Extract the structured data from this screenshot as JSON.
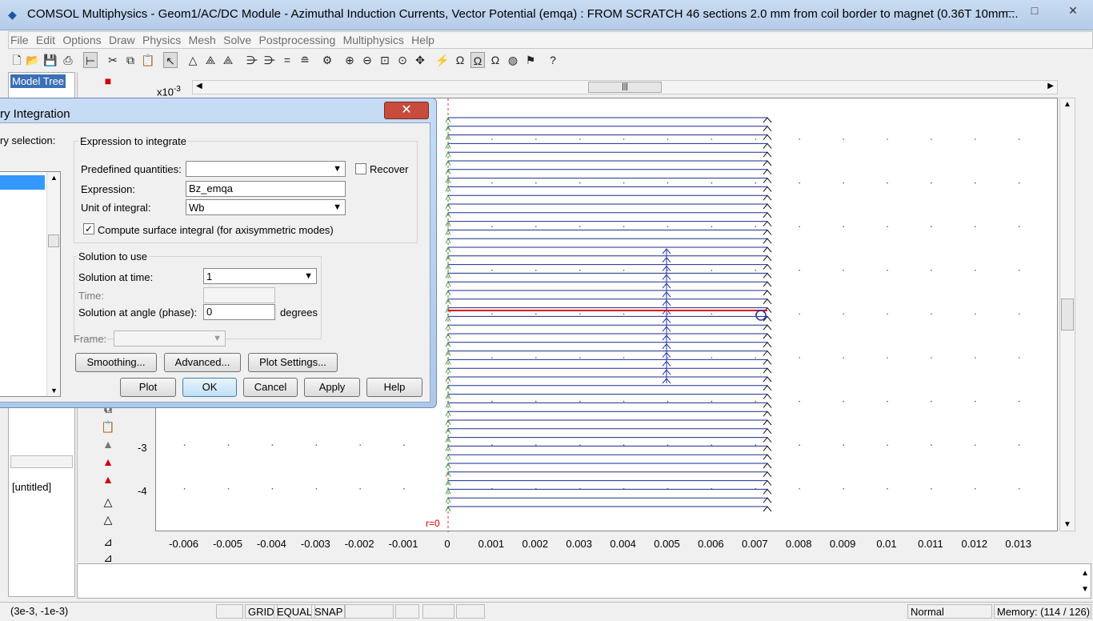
{
  "window": {
    "title": "COMSOL Multiphysics - Geom1/AC/DC Module - Azimuthal Induction Currents, Vector Potential (emqa) : FROM SCRATCH 46 sections 2.0 mm from coil border to magnet (0.36T 10mm...",
    "minimize": "—",
    "maximize": "□",
    "close": "✕"
  },
  "menu": [
    "File",
    "Edit",
    "Options",
    "Draw",
    "Physics",
    "Mesh",
    "Solve",
    "Postprocessing",
    "Multiphysics",
    "Help"
  ],
  "left_panel": {
    "tab": "Model Tree",
    "untitled": "[untitled]"
  },
  "plot": {
    "exponent_label": "x10",
    "exponent_power": "-3",
    "x_ticks": [
      "-0.006",
      "-0.005",
      "-0.004",
      "-0.003",
      "-0.002",
      "-0.001",
      "0",
      "0.001",
      "0.002",
      "0.003",
      "0.004",
      "0.005",
      "0.006",
      "0.007",
      "0.008",
      "0.009",
      "0.01",
      "0.011",
      "0.012",
      "0.013"
    ],
    "y_ticks": [
      "-3",
      "-4"
    ],
    "r0_label": "r=0"
  },
  "dialog": {
    "title": "ry Integration",
    "close": "✕",
    "boundary_selection_label": "ry selection:",
    "expression_group": "Expression to integrate",
    "predefined_label": "Predefined quantities:",
    "predefined_value": "",
    "recover_label": "Recover",
    "expression_label": "Expression:",
    "expression_value": "Bz_emqa",
    "unit_label": "Unit of integral:",
    "unit_value": "Wb",
    "compute_surface_label": "Compute surface integral (for axisymmetric modes)",
    "solution_group": "Solution to use",
    "solution_time_label": "Solution at time:",
    "solution_time_value": "1",
    "time_label": "Time:",
    "time_value": "",
    "angle_label": "Solution at angle (phase):",
    "angle_value": "0",
    "degrees_label": "degrees",
    "frame_label": "Frame:",
    "smoothing_button": "Smoothing...",
    "advanced_button": "Advanced...",
    "plot_settings_button": "Plot Settings...",
    "plot_button": "Plot",
    "ok_button": "OK",
    "cancel_button": "Cancel",
    "apply_button": "Apply",
    "help_button": "Help"
  },
  "status": {
    "coords": "(3e-3, -1e-3)",
    "grid": "GRID",
    "equal": "EQUAL",
    "snap": "SNAP",
    "mode": "Normal",
    "memory": "Memory: (114 / 126)"
  }
}
